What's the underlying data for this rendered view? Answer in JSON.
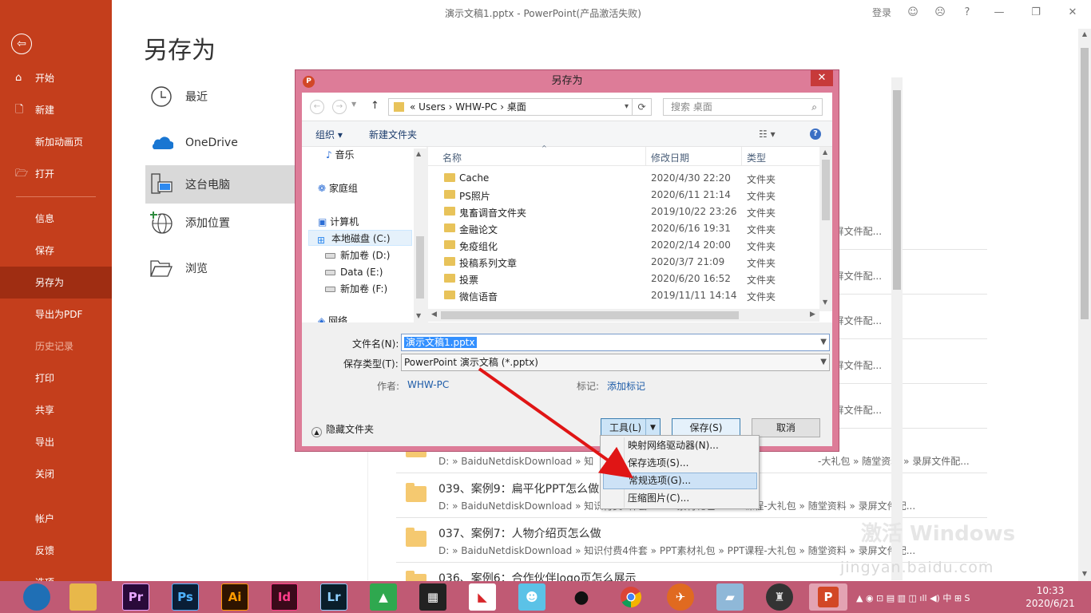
{
  "window_title": "演示文稿1.pptx  -  PowerPoint(产品激活失败)",
  "titlebar": {
    "login": "登录",
    "happy": "☺",
    "sad": "☹",
    "help": "?",
    "restore": "❐",
    "close": "✕"
  },
  "backstage": {
    "back": "⇦",
    "items": [
      {
        "label": "开始",
        "icon": "⌂"
      },
      {
        "label": "新建",
        "icon": "🗋"
      },
      {
        "label": "新加动画页",
        "icon": ""
      },
      {
        "label": "打开",
        "icon": "🗁"
      },
      {
        "label": "信息",
        "icon": ""
      },
      {
        "label": "保存",
        "icon": ""
      },
      {
        "label": "另存为",
        "icon": ""
      },
      {
        "label": "导出为PDF",
        "icon": ""
      },
      {
        "label": "历史记录",
        "icon": ""
      },
      {
        "label": "打印",
        "icon": ""
      },
      {
        "label": "共享",
        "icon": ""
      },
      {
        "label": "导出",
        "icon": ""
      },
      {
        "label": "关闭",
        "icon": ""
      },
      {
        "label": "帐户",
        "icon": ""
      },
      {
        "label": "反馈",
        "icon": ""
      },
      {
        "label": "选项",
        "icon": ""
      }
    ]
  },
  "page_title": "另存为",
  "locations": [
    {
      "label": "最近",
      "icon": "clock-icon"
    },
    {
      "label": "OneDrive",
      "icon": "cloud-icon"
    },
    {
      "label": "这台电脑",
      "icon": "computer-icon"
    },
    {
      "label": "添加位置",
      "icon": "globe-plus-icon"
    },
    {
      "label": "浏览",
      "icon": "folder-open-icon"
    }
  ],
  "recent": {
    "row_tail": "› 录屏文件配...",
    "rows": [
      {
        "title": "039、案例9：扁平化PPT怎么做",
        "path": "D: » BaiduNetdiskDownload » 知识付费4件套 » PPT素材礼包 » PPT课程-大礼包 » 随堂资料 » 录屏文件配..."
      },
      {
        "title": "037、案例7：人物介绍页怎么做",
        "path": "D: » BaiduNetdiskDownload » 知识付费4件套 » PPT素材礼包 » PPT课程-大礼包 » 随堂资料 » 录屏文件配..."
      },
      {
        "title": "036、案例6：合作伙伴logo页怎么展示",
        "path": ""
      }
    ],
    "partial_path": "D: » BaiduNetdiskDownload » 知",
    "partial_tail": "-大礼包 » 随堂资料 » 录屏文件配..."
  },
  "dialog": {
    "title": "另存为",
    "close": "✕",
    "back_btn": "←",
    "fwd_btn": "→",
    "up_btn": "↑",
    "breadcrumb": "«  Users  ›  WHW-PC  ›  桌面",
    "refresh": "⟳",
    "search_placeholder": "搜索 桌面",
    "search_icon": "⌕",
    "organize": "组织 ▾",
    "new_folder": "新建文件夹",
    "view_icon": "☷  ▾",
    "help": "?",
    "tree": [
      "音乐",
      "家庭组",
      "计算机",
      "本地磁盘 (C:)",
      "新加卷 (D:)",
      "Data (E:)",
      "新加卷 (F:)",
      "网络"
    ],
    "columns": {
      "name": "名称",
      "date": "修改日期",
      "type": "类型"
    },
    "files": [
      {
        "name": "Cache",
        "date": "2020/4/30 22:20",
        "type": "文件夹"
      },
      {
        "name": "PS照片",
        "date": "2020/6/11 21:14",
        "type": "文件夹"
      },
      {
        "name": "鬼畜调音文件夹",
        "date": "2019/10/22 23:26",
        "type": "文件夹"
      },
      {
        "name": "金融论文",
        "date": "2020/6/16 19:31",
        "type": "文件夹"
      },
      {
        "name": "免疫组化",
        "date": "2020/2/14 20:00",
        "type": "文件夹"
      },
      {
        "name": "投稿系列文章",
        "date": "2020/3/7 21:09",
        "type": "文件夹"
      },
      {
        "name": "投票",
        "date": "2020/6/20 16:52",
        "type": "文件夹"
      },
      {
        "name": "微信语音",
        "date": "2019/11/11 14:14",
        "type": "文件夹"
      }
    ],
    "filename_label": "文件名(N):",
    "filename_value": "演示文稿1.pptx",
    "filetype_label": "保存类型(T):",
    "filetype_value": "PowerPoint 演示文稿 (*.pptx)",
    "author_label": "作者:",
    "author_value": "WHW-PC",
    "tags_label": "标记:",
    "tags_value": "添加标记",
    "hide_folders": "隐藏文件夹",
    "tools_btn": "工具(L)",
    "save_btn": "保存(S)",
    "cancel_btn": "取消",
    "tools_menu": [
      "映射网络驱动器(N)...",
      "保存选项(S)...",
      "常规选项(G)...",
      "压缩图片(C)..."
    ]
  },
  "watermark": {
    "line1": "激活 Windows",
    "line2": "jingyan.baidu.com"
  },
  "taskbar": {
    "apps": [
      {
        "label": "",
        "color": "#1f6fb5"
      },
      {
        "label": "",
        "color": "#e8b84a"
      },
      {
        "label": "Pr",
        "color": "#2a0a3a"
      },
      {
        "label": "Ps",
        "color": "#0a1e36"
      },
      {
        "label": "Ai",
        "color": "#2e1400"
      },
      {
        "label": "Id",
        "color": "#3a0a1a"
      },
      {
        "label": "Lr",
        "color": "#0a1e2a"
      },
      {
        "label": "",
        "color": "#2fa84f"
      },
      {
        "label": "",
        "color": "#222222"
      },
      {
        "label": "",
        "color": "#ffffff"
      },
      {
        "label": "",
        "color": "#5bc2e7"
      },
      {
        "label": "",
        "color": "#f5f5f5"
      },
      {
        "label": "",
        "color": "#ffffff"
      },
      {
        "label": "",
        "color": "#e06a20"
      },
      {
        "label": "",
        "color": "#8fb8d8"
      },
      {
        "label": "",
        "color": "#333333"
      },
      {
        "label": "P",
        "color": "#d24726"
      }
    ],
    "tray": "▲  ◉  ⊡  ▤  ▥  ◫  ıll  ◀)  中  ⊞  S",
    "time": "10:33",
    "date": "2020/6/21"
  }
}
